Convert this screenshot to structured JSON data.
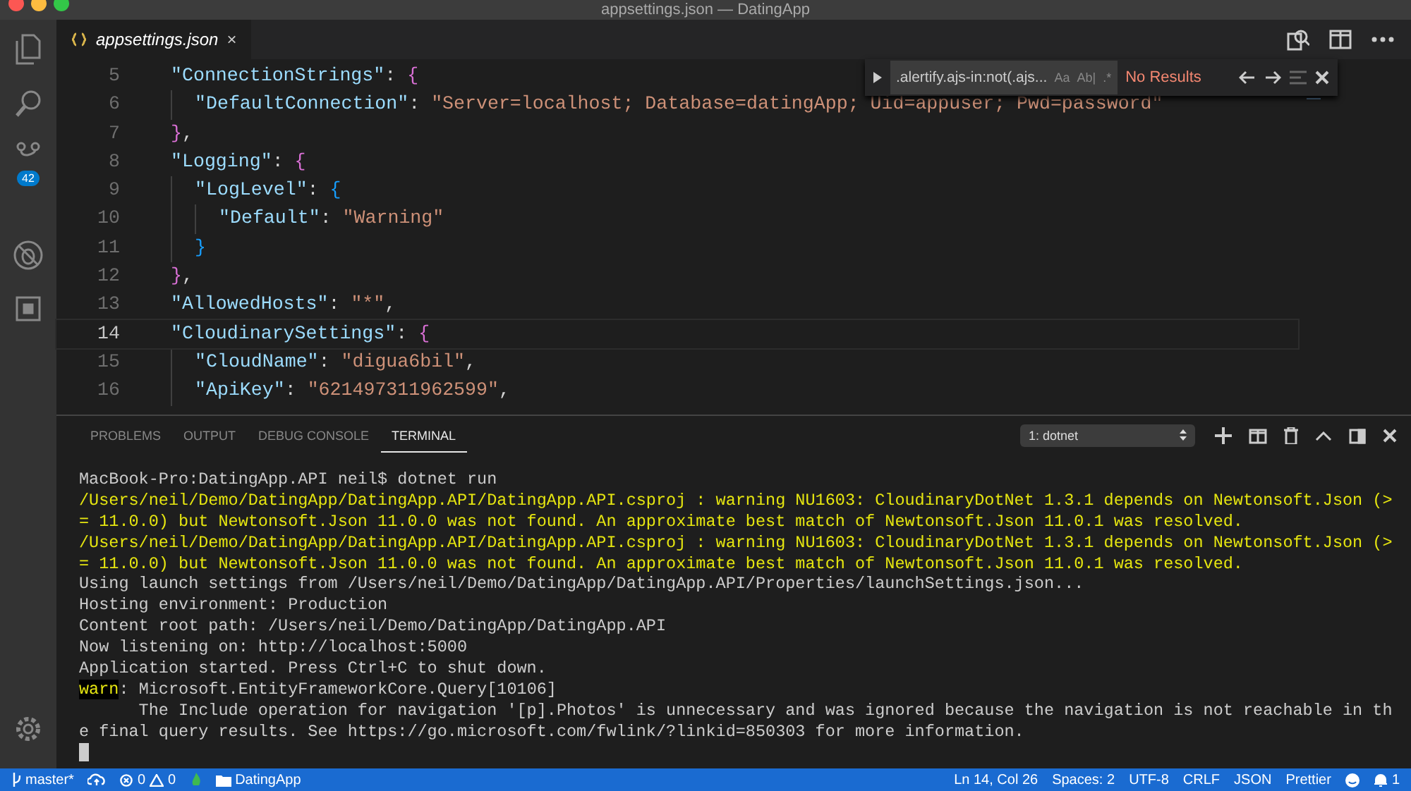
{
  "window": {
    "title": "appsettings.json — DatingApp"
  },
  "activity_bar": {
    "scm_badge": "42"
  },
  "tabs": [
    {
      "label": "appsettings.json",
      "selected": true,
      "close": "×"
    }
  ],
  "find_widget": {
    "value": ".alertify.ajs-in:not(.ajs...",
    "toggles": [
      "Aa",
      "Ab|",
      ".*"
    ],
    "result": "No Results"
  },
  "code_lines": [
    {
      "number": "5",
      "current": false,
      "tokens": [
        {
          "kind": "key",
          "text": "\"ConnectionStrings\""
        },
        {
          "kind": "punct",
          "text": ": "
        },
        {
          "kind": "brace",
          "text": "{"
        }
      ],
      "children": [
        {
          "number": "6",
          "current": false,
          "tokens": [
            {
              "kind": "key",
              "text": "\"DefaultConnection\""
            },
            {
              "kind": "punct",
              "text": ": "
            },
            {
              "kind": "string",
              "text": "\"Server=localhost; Database=datingApp; Uid=appuser; Pwd=password\""
            }
          ]
        }
      ]
    },
    {
      "number": "7",
      "current": false,
      "tokens": [
        {
          "kind": "brace",
          "text": "}"
        },
        {
          "kind": "punct",
          "text": ","
        }
      ]
    },
    {
      "number": "8",
      "current": false,
      "tokens": [
        {
          "kind": "key",
          "text": "\"Logging\""
        },
        {
          "kind": "punct",
          "text": ": "
        },
        {
          "kind": "brace",
          "text": "{"
        }
      ],
      "children": [
        {
          "number": "9",
          "current": false,
          "tokens": [
            {
              "kind": "key",
              "text": "\"LogLevel\""
            },
            {
              "kind": "punct",
              "text": ": "
            },
            {
              "kind": "brace2",
              "text": "{"
            }
          ],
          "children": [
            {
              "number": "10",
              "current": false,
              "tokens": [
                {
                  "kind": "key",
                  "text": "\"Default\""
                },
                {
                  "kind": "punct",
                  "text": ": "
                },
                {
                  "kind": "string",
                  "text": "\"Warning\""
                }
              ]
            }
          ]
        },
        {
          "number": "11",
          "current": false,
          "tokens": [
            {
              "kind": "brace2",
              "text": "}"
            }
          ]
        }
      ]
    },
    {
      "number": "12",
      "current": false,
      "tokens": [
        {
          "kind": "brace",
          "text": "}"
        },
        {
          "kind": "punct",
          "text": ","
        }
      ]
    },
    {
      "number": "13",
      "current": false,
      "tokens": [
        {
          "kind": "key",
          "text": "\"AllowedHosts\""
        },
        {
          "kind": "punct",
          "text": ": "
        },
        {
          "kind": "string",
          "text": "\"*\""
        },
        {
          "kind": "punct",
          "text": ","
        }
      ]
    },
    {
      "number": "14",
      "current": true,
      "tokens": [
        {
          "kind": "key",
          "text": "\"CloudinarySettings\""
        },
        {
          "kind": "punct",
          "text": ": "
        },
        {
          "kind": "brace",
          "text": "{"
        }
      ],
      "children": [
        {
          "number": "15",
          "current": false,
          "tokens": [
            {
              "kind": "key",
              "text": "\"CloudName\""
            },
            {
              "kind": "punct",
              "text": ": "
            },
            {
              "kind": "string",
              "text": "\"digua6bil\""
            },
            {
              "kind": "punct",
              "text": ","
            }
          ]
        },
        {
          "number": "16",
          "current": false,
          "tokens": [
            {
              "kind": "key",
              "text": "\"ApiKey\""
            },
            {
              "kind": "punct",
              "text": ": "
            },
            {
              "kind": "string",
              "text": "\"621497311962599\""
            },
            {
              "kind": "punct",
              "text": ","
            }
          ]
        }
      ]
    }
  ],
  "panel": {
    "tabs": [
      {
        "label": "PROBLEMS",
        "selected": false
      },
      {
        "label": "OUTPUT",
        "selected": false
      },
      {
        "label": "DEBUG CONSOLE",
        "selected": false
      },
      {
        "label": "TERMINAL",
        "selected": true
      }
    ],
    "terminal_select": "1: dotnet",
    "terminal_lines": [
      [
        {
          "kind": "normal",
          "text": "MacBook-Pro:DatingApp.API neil$ dotnet run"
        }
      ],
      [
        {
          "kind": "warning",
          "text": "/Users/neil/Demo/DatingApp/DatingApp.API/DatingApp.API.csproj : warning NU1603: CloudinaryDotNet 1.3.1 depends on Newtonsoft.Json (>"
        }
      ],
      [
        {
          "kind": "warning",
          "text": "= 11.0.0) but Newtonsoft.Json 11.0.0 was not found. An approximate best match of Newtonsoft.Json 11.0.1 was resolved."
        }
      ],
      [
        {
          "kind": "warning",
          "text": "/Users/neil/Demo/DatingApp/DatingApp.API/DatingApp.API.csproj : warning NU1603: CloudinaryDotNet 1.3.1 depends on Newtonsoft.Json (>"
        }
      ],
      [
        {
          "kind": "warning",
          "text": "= 11.0.0) but Newtonsoft.Json 11.0.0 was not found. An approximate best match of Newtonsoft.Json 11.0.1 was resolved."
        }
      ],
      [
        {
          "kind": "normal",
          "text": "Using launch settings from /Users/neil/Demo/DatingApp/DatingApp.API/Properties/launchSettings.json..."
        }
      ],
      [
        {
          "kind": "normal",
          "text": "Hosting environment: Production"
        }
      ],
      [
        {
          "kind": "normal",
          "text": "Content root path: /Users/neil/Demo/DatingApp/DatingApp.API"
        }
      ],
      [
        {
          "kind": "normal",
          "text": "Now listening on: http://localhost:5000"
        }
      ],
      [
        {
          "kind": "normal",
          "text": "Application started. Press Ctrl+C to shut down."
        }
      ],
      [
        {
          "kind": "warn_label",
          "text": "warn"
        },
        {
          "kind": "normal",
          "text": ": Microsoft.EntityFrameworkCore.Query[10106]"
        }
      ],
      [
        {
          "kind": "normal",
          "text": "      The Include operation for navigation '[p].Photos' is unnecessary and was ignored because the navigation is not reachable in th"
        }
      ],
      [
        {
          "kind": "normal",
          "text": "e final query results. See https://go.microsoft.com/fwlink/?linkid=850303 for more information."
        }
      ]
    ]
  },
  "status_bar": {
    "branch": "master*",
    "errors": "0",
    "warnings": "0",
    "folder": "DatingApp",
    "right": [
      "Ln 14, Col 26",
      "Spaces: 2",
      "UTF-8",
      "CRLF",
      "JSON",
      "Prettier"
    ],
    "notifications": "1"
  }
}
